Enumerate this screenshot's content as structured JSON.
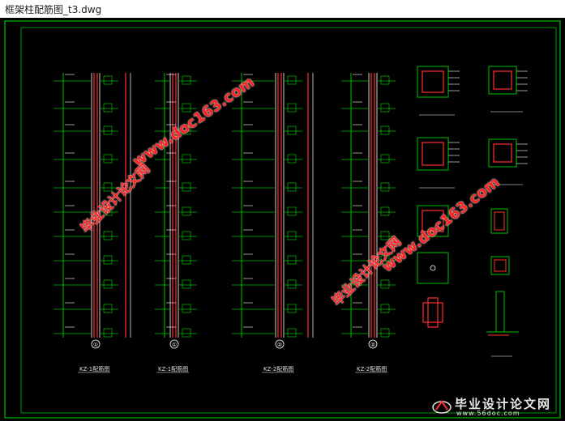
{
  "window": {
    "title": "框架柱配筋图_t3.dwg"
  },
  "drawing": {
    "colors": {
      "background": "#000000",
      "frame": "#00c000",
      "rebar": "#ff3030",
      "line": "#ffffff",
      "text": "#e0e0e0"
    },
    "column_labels": [
      "KZ-1配筋图",
      "KZ-1配筋图",
      "KZ-2配筋图",
      "KZ-2配筋图"
    ],
    "axis_markers": [
      "①",
      "①",
      "②",
      "②"
    ]
  },
  "watermarks": {
    "url": "www.doc163.com",
    "cn": "毕业设计论文网"
  },
  "logo": {
    "cn": "毕业设计论文网",
    "url": "www.56doc.com",
    "icon": "logo-icon"
  }
}
